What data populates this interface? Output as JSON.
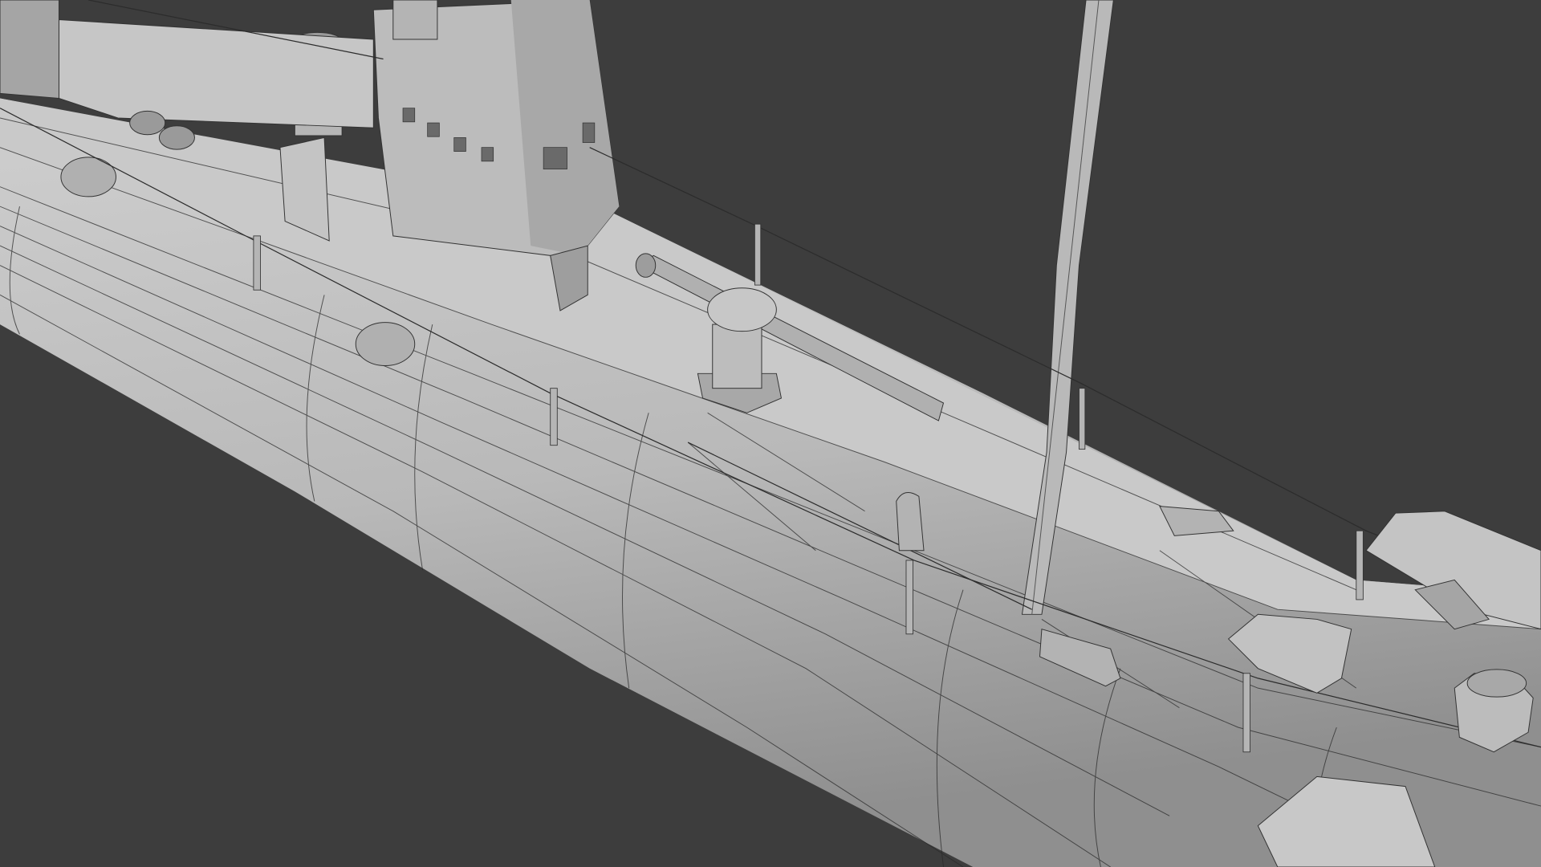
{
  "scene": {
    "subject": "submarine-wireframe-model",
    "colors": {
      "background": "#3d3d3d",
      "hull": "#bdbdbd",
      "hull_shadow": "#9a9a9a",
      "hull_light": "#d2d2d2",
      "wire": "#2a2a2a"
    }
  }
}
